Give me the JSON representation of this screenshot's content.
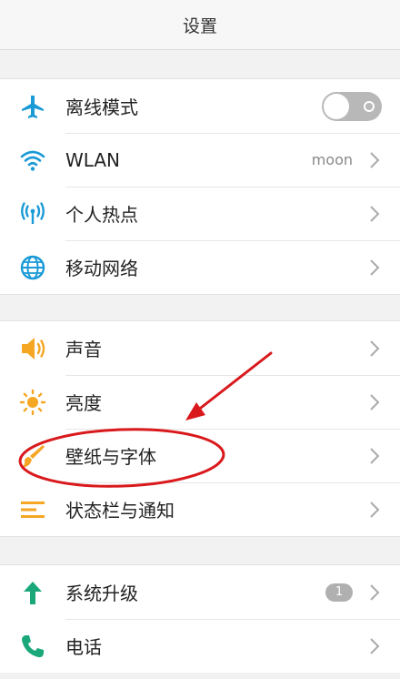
{
  "header": {
    "title": "设置"
  },
  "group1": {
    "airplane": {
      "label": "离线模式",
      "toggle_on": false,
      "icon": "airplane-icon"
    },
    "wlan": {
      "label": "WLAN",
      "value": "moon",
      "icon": "wifi-icon"
    },
    "hotspot": {
      "label": "个人热点",
      "icon": "hotspot-icon"
    },
    "mobile": {
      "label": "移动网络",
      "icon": "globe-icon"
    }
  },
  "group2": {
    "sound": {
      "label": "声音",
      "icon": "speaker-icon"
    },
    "brightness": {
      "label": "亮度",
      "icon": "sun-icon"
    },
    "wallpaper": {
      "label": "壁纸与字体",
      "icon": "brush-icon"
    },
    "statusbar": {
      "label": "状态栏与通知",
      "icon": "list-icon"
    }
  },
  "group3": {
    "update": {
      "label": "系统升级",
      "badge": "1",
      "icon": "up-arrow-icon"
    },
    "phone": {
      "label": "电话",
      "icon": "phone-icon"
    }
  },
  "colors": {
    "blue": "#1a9ad6",
    "orange": "#f5a623",
    "green": "#1aa87a",
    "annotation_red": "#d9191c"
  }
}
